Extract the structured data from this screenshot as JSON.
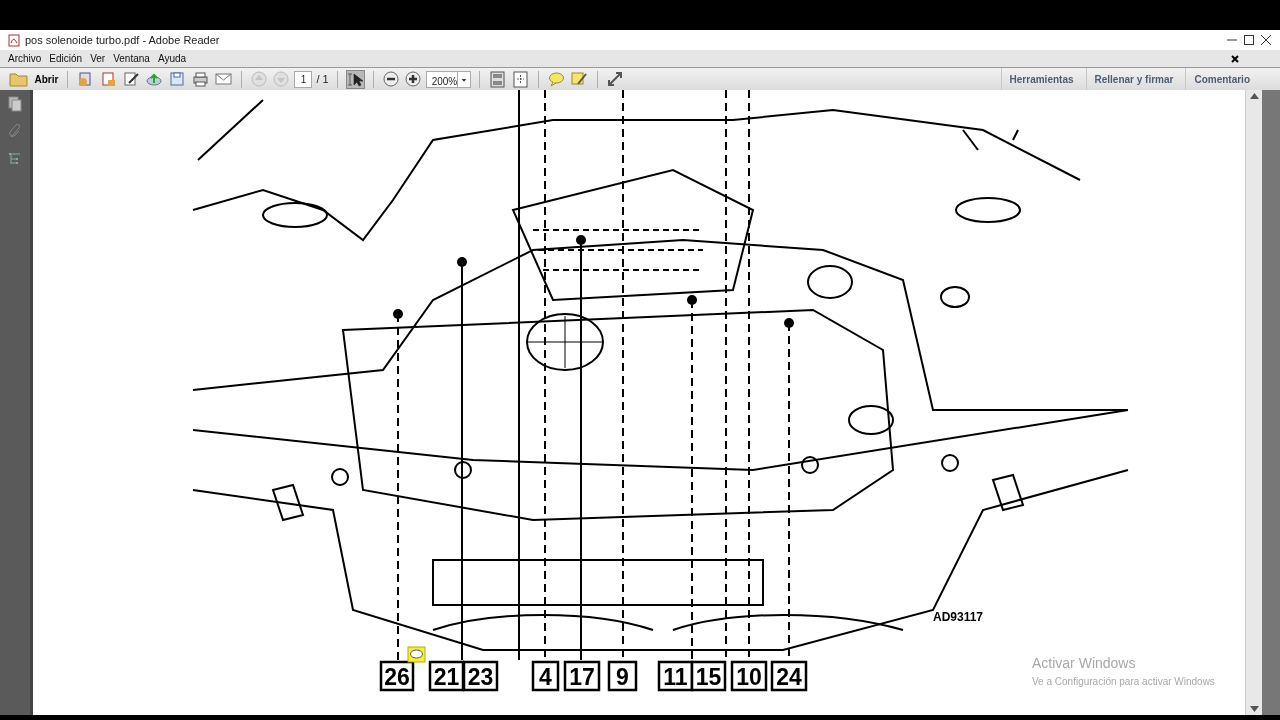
{
  "window": {
    "title": "pos solenoide turbo.pdf - Adobe Reader"
  },
  "menu": [
    "Archivo",
    "Edición",
    "Ver",
    "Ventana",
    "Ayuda"
  ],
  "toolbar": {
    "open_label": "Abrir",
    "prev_page": {
      "disabled": true
    },
    "next_page": {
      "disabled": true
    },
    "page_number": "1",
    "page_count": "/ 1",
    "select_tool": {
      "selected": true
    },
    "zoom": "200%"
  },
  "panels": [
    {
      "label": "Herramientas"
    },
    {
      "label": "Rellenar y firmar"
    },
    {
      "label": "Comentario"
    }
  ],
  "document": {
    "diagram_code": "AD93117",
    "callouts": [
      {
        "labels": [
          "26"
        ]
      },
      {
        "labels": [
          "21",
          "23"
        ]
      },
      {
        "labels": [
          "4"
        ]
      },
      {
        "labels": [
          "17"
        ]
      },
      {
        "labels": [
          "9"
        ]
      },
      {
        "labels": [
          "11",
          "15"
        ]
      },
      {
        "labels": [
          "10"
        ]
      },
      {
        "labels": [
          "24"
        ]
      }
    ]
  },
  "activation_notice": {
    "title": "Activar Windows",
    "text": "Ve a Configuración para activar Windows"
  }
}
